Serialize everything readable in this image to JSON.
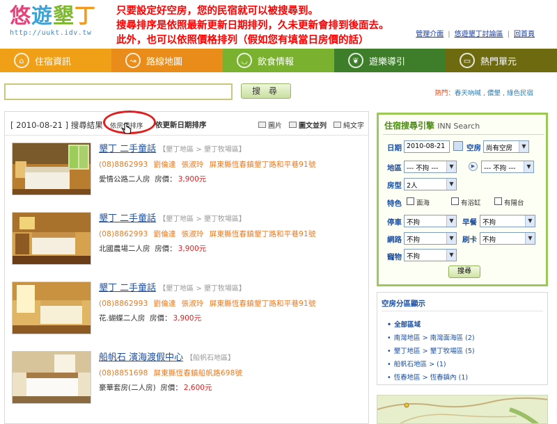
{
  "header": {
    "logo_text": [
      "悠",
      "遊",
      "墾",
      "丁"
    ],
    "logo_url": "http://uukt.idv.tw",
    "note_lines": [
      "只要設定好空房，您的民宿就可以被搜尋到。",
      "搜尋排序是依照最新更新日期排列，久未更新會排到後面去。",
      "此外，也可以依照價格排列（假如您有填當日房價的話）"
    ],
    "top_links": [
      "管理介面",
      "悠遊墾丁討論區",
      "回首頁"
    ]
  },
  "nav": [
    {
      "label": "住宿資訊",
      "icon": "house-icon"
    },
    {
      "label": "路線地圖",
      "icon": "route-icon"
    },
    {
      "label": "飲食情報",
      "icon": "bowl-icon"
    },
    {
      "label": "遊樂導引",
      "icon": "leaf-icon"
    },
    {
      "label": "熱門單元",
      "icon": "tv-icon"
    }
  ],
  "search": {
    "value": "",
    "button": "搜 尋",
    "hot_label": "熱門：",
    "hot_links": "春天吶喊 , 儂墾 , 綠色民宿"
  },
  "results": {
    "title": "[ 2010-08-21 ] 搜尋結果",
    "sort_price": "依房價排序",
    "sort_update": "依更新日期排序",
    "views": [
      "圖片",
      "圖文並列",
      "純文字"
    ]
  },
  "listings": [
    {
      "name": "墾丁 二手童話",
      "area": "【墾丁地區 > 墾丁牧場區】",
      "phone": "(08)8862993",
      "owner1": "劉倫達",
      "owner2": "張淑玲",
      "address": "屏東縣恆春鎮墾丁路和平巷91號",
      "room": "愛情公路二人房",
      "price_label": "房價：",
      "price": "3,900元"
    },
    {
      "name": "墾丁 二手童話",
      "area": "【墾丁地區 > 墾丁牧場區】",
      "phone": "(08)8862993",
      "owner1": "劉倫達",
      "owner2": "張淑玲",
      "address": "屏東縣恆春鎮墾丁路和平巷91號",
      "room": "北國農場二人房",
      "price_label": "房價：",
      "price": "3,900元"
    },
    {
      "name": "墾丁 二手童話",
      "area": "【墾丁地區 > 墾丁牧場區】",
      "phone": "(08)8862993",
      "owner1": "劉倫達",
      "owner2": "張淑玲",
      "address": "屏東縣恆春鎮墾丁路和平巷91號",
      "room": "花.蝴蝶二人房",
      "price_label": "房價：",
      "price": "3,900元"
    },
    {
      "name": "船帆石 濱海渡假中心",
      "area": "【船帆石地區】",
      "phone": "(08)8851698",
      "owner1": "",
      "owner2": "",
      "address": "屏東縣恆春鎮船帆路698號",
      "room": "豪華套房(二人房)",
      "price_label": "房價：",
      "price": "2,600元"
    }
  ],
  "engine": {
    "title": "住宿搜尋引擎",
    "subtitle": "INN Search",
    "date_label": "日期",
    "date_value": "2010-08-21",
    "vacancy_label": "空房",
    "vacancy_value": "尚有空房",
    "region_label": "地區",
    "region_value": "--- 不拘 ---",
    "subregion_value": "--- 不拘 ---",
    "roomtype_label": "房型",
    "roomtype_value": "2人",
    "view_label": "特色",
    "view_options": [
      "面海",
      "有浴缸",
      "有陽台"
    ],
    "parking_label": "停車",
    "parking_value": "不拘",
    "breakfast_label": "早餐",
    "breakfast_value": "不拘",
    "internet_label": "網路",
    "internet_value": "不拘",
    "card_label": "刷卡",
    "card_value": "不拘",
    "pet_label": "寵物",
    "pet_value": "不拘",
    "button": "搜尋"
  },
  "areas": {
    "title": "空房分區顯示",
    "items": [
      "全部區域",
      "南灣地區 > 南灣面海區 (2)",
      "墾丁地區 > 墾丁牧場區 (5)",
      "船帆石地區 > (1)",
      "恆春地區 > 恆春鎮內 (1)"
    ]
  },
  "colors": {
    "note": "#ff0000",
    "nav_1": "#f0a017",
    "nav_2": "#e98c1a",
    "nav_3": "#7ab12f",
    "nav_4": "#3e7e2a",
    "nav_5": "#6e6a10",
    "link": "#1d4fa0",
    "price": "#e01e1e"
  }
}
